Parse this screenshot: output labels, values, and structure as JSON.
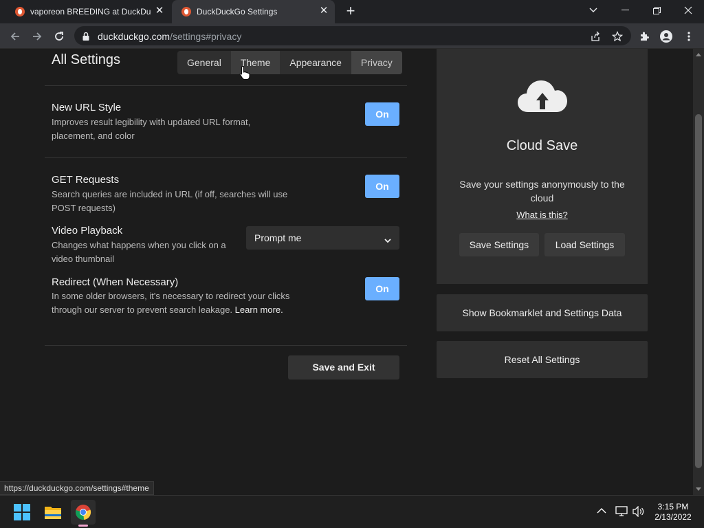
{
  "browser": {
    "tabs": [
      {
        "title": "vaporeon BREEDING at DuckDuc",
        "active": false
      },
      {
        "title": "DuckDuckGo Settings",
        "active": true
      }
    ],
    "url_host": "duckduckgo.com",
    "url_path": "/settings#privacy"
  },
  "settings": {
    "title": "All Settings",
    "tabs": [
      "General",
      "Theme",
      "Appearance",
      "Privacy"
    ],
    "items": [
      {
        "title": "New URL Style",
        "desc": "Improves result legibility with updated URL format, placement, and color",
        "toggle": "On"
      },
      {
        "title": "GET Requests",
        "desc": "Search queries are included in URL (if off, searches will use POST requests)",
        "toggle": "On"
      },
      {
        "title": "Video Playback",
        "desc": "Changes what happens when you click on a video thumbnail",
        "select": "Prompt me"
      },
      {
        "title": "Redirect (When Necessary)",
        "desc": "In some older browsers, it's necessary to redirect your clicks through our server to prevent search leakage.",
        "more": "Learn more.",
        "toggle": "On"
      }
    ],
    "save_exit": "Save and Exit"
  },
  "cloud": {
    "title": "Cloud Save",
    "desc": "Save your settings anonymously to the cloud",
    "link": "What is this?",
    "save": "Save Settings",
    "load": "Load Settings"
  },
  "bookmarklet": "Show Bookmarklet and Settings Data",
  "reset": "Reset All Settings",
  "status_url": "https://duckduckgo.com/settings#theme",
  "clock": {
    "time": "3:15 PM",
    "date": "2/13/2022"
  },
  "colors": {
    "toggle_on": "#6aafff",
    "page_bg": "#1c1c1c",
    "panel_bg": "#2f2f2f"
  },
  "icons": [
    "duckduckgo-favicon",
    "back-icon",
    "forward-icon",
    "reload-icon",
    "lock-icon",
    "share-icon",
    "star-icon",
    "extensions-icon",
    "profile-icon",
    "menu-icon",
    "cloud-upload-icon",
    "chevron-down-icon",
    "windows-start-icon",
    "file-explorer-icon",
    "chrome-icon",
    "tray-chevron-icon",
    "network-icon",
    "volume-icon"
  ]
}
